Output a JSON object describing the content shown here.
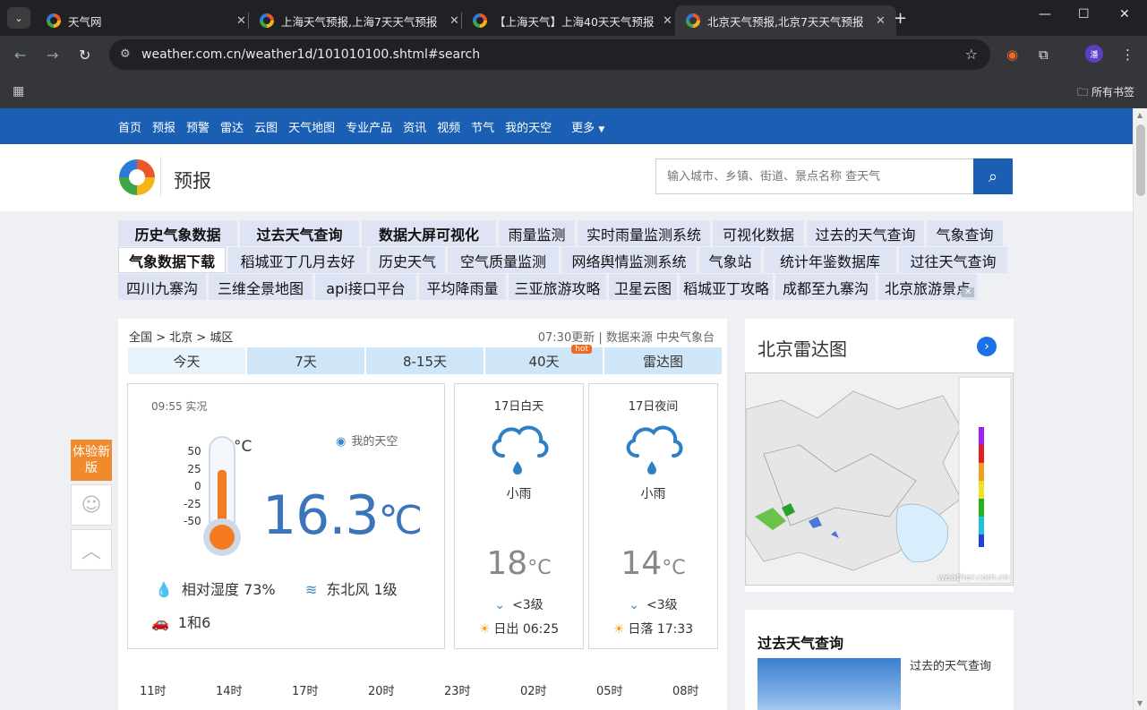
{
  "browser": {
    "tabs": [
      {
        "title": "天气网"
      },
      {
        "title": "上海天气预报,上海7天天气预报"
      },
      {
        "title": "【上海天气】上海40天天气预报"
      },
      {
        "title": "北京天气预报,北京7天天气预报"
      }
    ],
    "url": "weather.com.cn/weather1d/101010100.shtml#search",
    "bookmarks_all": "所有书签",
    "profile_initial": "潘"
  },
  "nav": {
    "items": [
      "首页",
      "预报",
      "预警",
      "雷达",
      "云图",
      "天气地图",
      "专业产品",
      "资讯",
      "视频",
      "节气",
      "我的天空"
    ],
    "more": "更多"
  },
  "header": {
    "title": "预报",
    "search_placeholder": "输入城市、乡镇、街道、景点名称 查天气"
  },
  "ad_links": {
    "row1": [
      "历史气象数据",
      "过去天气查询",
      "数据大屏可视化",
      "雨量监测",
      "实时雨量监测系统",
      "可视化数据",
      "过去的天气查询",
      "气象查询"
    ],
    "row2": [
      "气象数据下载",
      "稻城亚丁几月去好",
      "历史天气",
      "空气质量监测",
      "网络舆情监测系统",
      "气象站",
      "统计年鉴数据库",
      "过往天气查询"
    ],
    "row3": [
      "四川九寨沟",
      "三维全景地图",
      "api接口平台",
      "平均降雨量",
      "三亚旅游攻略",
      "卫星云图",
      "稻城亚丁攻略",
      "成都至九寨沟",
      "北京旅游景点"
    ]
  },
  "main": {
    "breadcrumb": "全国 > 北京 > 城区",
    "update": "07:30更新 | 数据来源 中央气象台",
    "tabs": [
      "今天",
      "7天",
      "8-15天",
      "40天",
      "雷达图"
    ],
    "hot": "hot",
    "now": {
      "time": "09:55 实况",
      "my_weather": "我的天空",
      "scale": [
        "50",
        "25",
        "0",
        "-25",
        "-50"
      ],
      "scale_unit": "°C",
      "temp": "16.3",
      "temp_unit": "℃",
      "humidity": "相对湿度  73%",
      "wind": "东北风  1级",
      "limit": "1和6"
    },
    "day": {
      "label": "17日白天",
      "desc": "小雨",
      "temp": "18",
      "unit": "°C",
      "wind": "<3级",
      "sun": "日出 06:25"
    },
    "night": {
      "label": "17日夜间",
      "desc": "小雨",
      "temp": "14",
      "unit": "°C",
      "wind": "<3级",
      "sun": "日落 17:33"
    },
    "hours": [
      "11时",
      "14时",
      "17时",
      "20时",
      "23时",
      "02时",
      "05时",
      "08时"
    ]
  },
  "side": {
    "new_version": "体验新版",
    "radar_title": "北京雷达图",
    "radar_watermark": "weather.com.cn",
    "past_title": "过去天气查询",
    "past_link": "过去的天气查询"
  },
  "colors": {
    "brand": "#1b5fb5",
    "accent": "#f47b20"
  }
}
